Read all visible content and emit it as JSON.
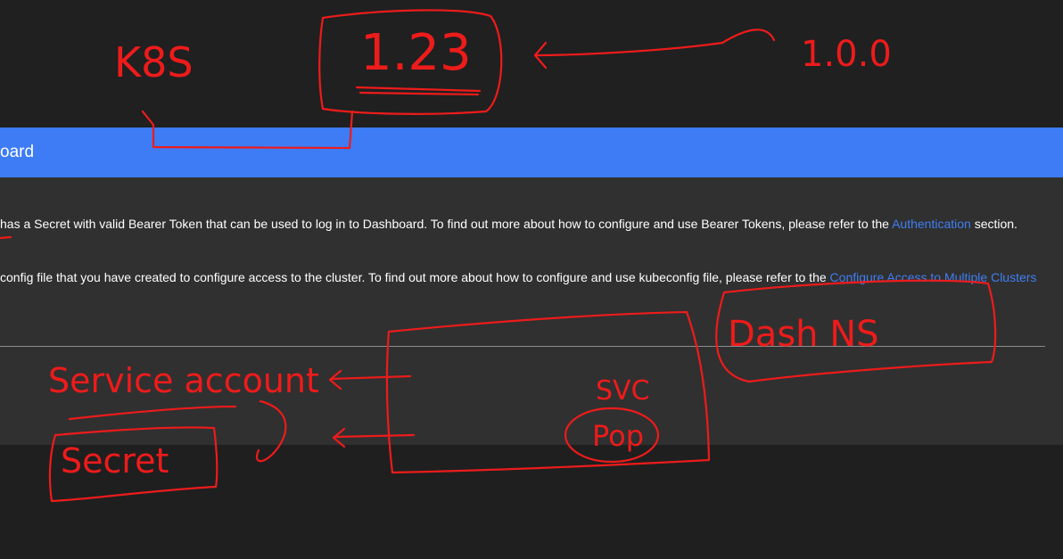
{
  "header": {
    "title": "oard"
  },
  "content": {
    "line1_text": "has a Secret with valid Bearer Token that can be used to log in to Dashboard. To find out more about how to configure and use Bearer Tokens, please refer to the ",
    "line1_link": "Authentication",
    "line1_suffix": " section.",
    "line2_text": "config file that you have created to configure access to the cluster. To find out more about how to configure and use kubeconfig file, please refer to the ",
    "line2_link": "Configure Access to Multiple Clusters"
  },
  "annotations": {
    "k8s": "K8S",
    "version": "1.23",
    "old_version": "1.0.0",
    "service_account": "Service account",
    "secret": "Secret",
    "svc": "SVC",
    "pod": "Pop",
    "dash_ns": "Dash NS"
  },
  "colors": {
    "header_bg": "#3d7cf5",
    "link": "#3f7ef2",
    "annotation": "#ee1b1b",
    "card_bg": "#303030",
    "page_bg": "#202020"
  }
}
